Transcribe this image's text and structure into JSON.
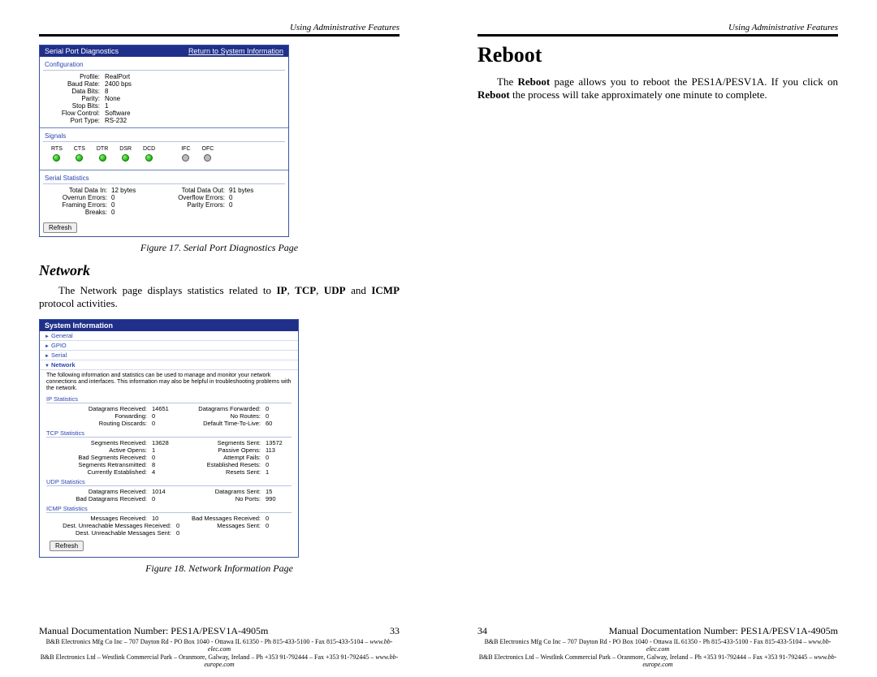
{
  "left": {
    "runningHead": "Using Administrative Features",
    "fig17": {
      "title": "Serial Port Diagnostics",
      "returnLink": "Return to System Information",
      "configHd": "Configuration",
      "config": {
        "profileL": "Profile:",
        "profileV": "RealPort",
        "baudL": "Baud Rate:",
        "baudV": "2400 bps",
        "dataL": "Data Bits:",
        "dataV": "8",
        "parityL": "Parity:",
        "parityV": "None",
        "stopL": "Stop Bits:",
        "stopV": "1",
        "flowL": "Flow Control:",
        "flowV": "Software",
        "portL": "Port Type:",
        "portV": "RS-232"
      },
      "signalsHd": "Signals",
      "signals": {
        "rts": "RTS",
        "cts": "CTS",
        "dtr": "DTR",
        "dsr": "DSR",
        "dcd": "DCD",
        "ifc": "IFC",
        "ofc": "OFC"
      },
      "statsHd": "Serial Statistics",
      "stats": {
        "tdiL": "Total Data In:",
        "tdiV": "12 bytes",
        "tdoL": "Total Data Out:",
        "tdoV": "91 bytes",
        "oeL": "Overrun Errors:",
        "oeV": "0",
        "ofL": "Overflow Errors:",
        "ofV": "0",
        "feL": "Framing Errors:",
        "feV": "0",
        "peL": "Parity Errors:",
        "peV": "0",
        "brL": "Breaks:",
        "brV": "0"
      },
      "refresh": "Refresh",
      "caption": "Figure 17.  Serial Port Diagnostics Page"
    },
    "networkHeading": "Network",
    "networkPara1a": "The Network page displays statistics related to ",
    "ip": "IP",
    "tcp": "TCP",
    "udp": "UDP",
    "and": " and ",
    "icmp": "ICMP",
    "networkPara1b": " protocol activities.",
    "fig18": {
      "title": "System Information",
      "navGeneral": "General",
      "navGPIO": "GPIO",
      "navSerial": "Serial",
      "navNetwork": "Network",
      "desc": "The following information and statistics can be used to manage and monitor your network connections and interfaces. This information may also be helpful in troubleshooting problems with the network.",
      "ipHd": "IP Statistics",
      "ip": {
        "drL": "Datagrams Received:",
        "drV": "14651",
        "dfL": "Datagrams Forwarded:",
        "dfV": "0",
        "fwL": "Forwarding:",
        "fwV": "0",
        "nrL": "No Routes:",
        "nrV": "0",
        "rdL": "Routing Discards:",
        "rdV": "0",
        "ttlL": "Default Time-To-Live:",
        "ttlV": "60"
      },
      "tcpHd": "TCP Statistics",
      "tcp": {
        "srL": "Segments Received:",
        "srV": "13628",
        "ssL": "Segments Sent:",
        "ssV": "13572",
        "aoL": "Active Opens:",
        "aoV": "1",
        "poL": "Passive Opens:",
        "poV": "113",
        "bsL": "Bad Segments Received:",
        "bsV": "0",
        "afL": "Attempt Fails:",
        "afV": "0",
        "reL": "Segments Retransmitted:",
        "reV": "8",
        "erL": "Established Resets:",
        "erV": "0",
        "ceL": "Currently Established:",
        "ceV": "4",
        "rsL": "Resets Sent:",
        "rsV": "1"
      },
      "udpHd": "UDP Statistics",
      "udp": {
        "drL": "Datagrams Received:",
        "drV": "1014",
        "dsL": "Datagrams Sent:",
        "dsV": "15",
        "bdL": "Bad Datagrams Received:",
        "bdV": "0",
        "npL": "No Ports:",
        "npV": "990"
      },
      "icmpHd": "ICMP Statistics",
      "icmp": {
        "mrL": "Messages Received:",
        "mrV": "10",
        "bmL": "Bad Messages Received:",
        "bmV": "0",
        "duL": "Dest. Unreachable Messages Received:",
        "duV": "0",
        "msL": "Messages Sent:",
        "msV": "0",
        "dsL": "Dest. Unreachable Messages Sent:",
        "dsV": "0"
      },
      "refresh": "Refresh",
      "caption": "Figure 18.  Network Information Page"
    },
    "footDoc": "Manual Documentation Number:  PES1A/PESV1A-4905m",
    "footPage": "33",
    "footLine1": "B&B Electronics Mfg Co Inc – 707 Dayton Rd - PO Box 1040 - Ottawa IL 61350 - Ph 815-433-5100 - Fax 815-433-5104 – ",
    "footLine1it": "www.bb-elec.com",
    "footLine2": "B&B Electronics Ltd – Westlink Commercial Park – Oranmore, Galway, Ireland – Ph +353 91-792444 – Fax +353 91-792445 – ",
    "footLine2it": "www.bb-europe.com"
  },
  "right": {
    "runningHead": "Using Administrative Features",
    "h1": "Reboot",
    "p1a": "The ",
    "p1b": "Reboot",
    "p1c": " page allows you to reboot the PES1A/PESV1A. If you click on ",
    "p1d": "Reboot",
    "p1e": " the process will take approximately one minute to complete.",
    "footPage": "34",
    "footDoc": "Manual Documentation Number: PES1A/PESV1A-4905m",
    "footLine1": "B&B Electronics Mfg Co Inc – 707 Dayton Rd - PO Box 1040 - Ottawa IL 61350 - Ph 815-433-5100 - Fax 815-433-5104 – ",
    "footLine1it": "www.bb-elec.com",
    "footLine2": "B&B Electronics Ltd – Westlink Commercial Park – Oranmore, Galway, Ireland – Ph +353 91-792444 – Fax +353 91-792445 – ",
    "footLine2it": "www.bb-europe.com"
  }
}
